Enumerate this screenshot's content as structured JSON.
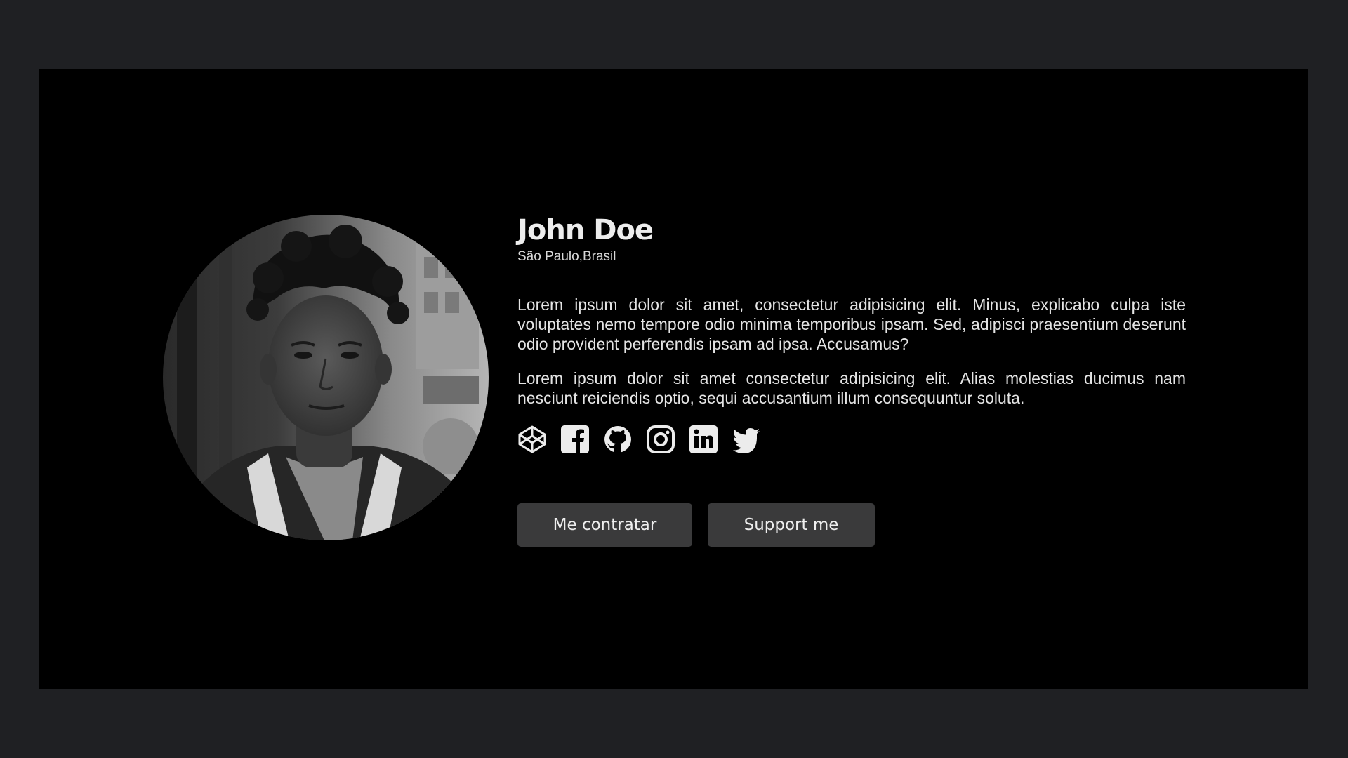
{
  "profile": {
    "name": "John Doe",
    "location": "São Paulo,Brasil",
    "bio": [
      "Lorem ipsum dolor sit amet, consectetur adipisicing elit. Minus, explicabo culpa iste voluptates nemo tempore odio minima temporibus ipsam. Sed, adipisci praesentium deserunt odio provident perferendis ipsam ad ipsa. Accusamus?",
      "Lorem ipsum dolor sit amet consectetur adipisicing elit. Alias molestias ducimus nam nesciunt reiciendis optio, sequi accusantium illum consequuntur soluta."
    ]
  },
  "socials": [
    {
      "icon": "codepen-icon"
    },
    {
      "icon": "facebook-icon"
    },
    {
      "icon": "github-icon"
    },
    {
      "icon": "instagram-icon"
    },
    {
      "icon": "linkedin-icon"
    },
    {
      "icon": "twitter-icon"
    }
  ],
  "buttons": {
    "hire_label": "Me contratar",
    "support_label": "Support me"
  },
  "colors": {
    "page_background": "#1f2023",
    "card_background": "#000000",
    "button_background": "#3a3a3b",
    "text": "#e9e9e9"
  }
}
